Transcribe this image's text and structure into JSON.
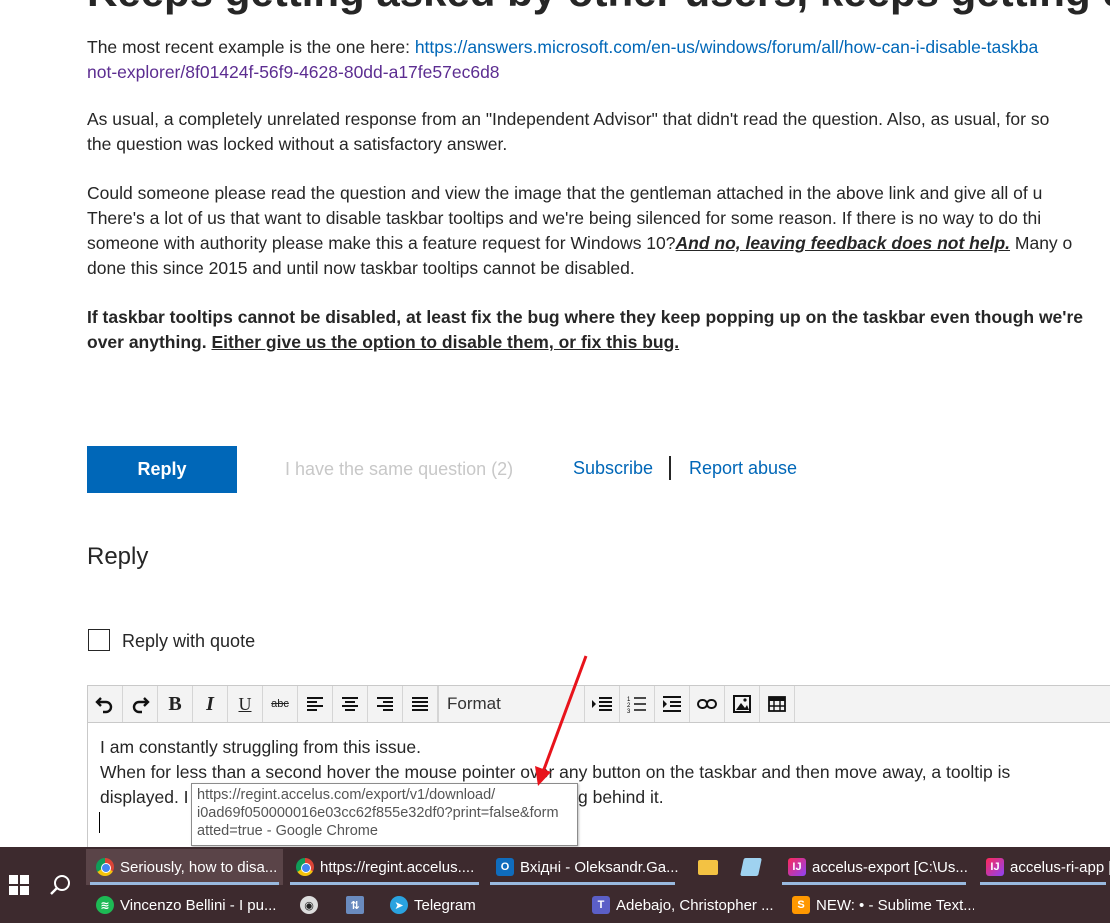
{
  "post": {
    "title": "Keeps getting asked by other users, keeps getting de",
    "p1_prefix": "The most recent example is the one here: ",
    "p1_link_line1": "https://answers.microsoft.com/en-us/windows/forum/all/how-can-i-disable-taskba",
    "p1_link_line2": "not-explorer/8f01424f-56f9-4628-80dd-a17fe57ec6d8",
    "p2_line1": "As usual, a completely unrelated response from an \"Independent Advisor\" that didn't read the question. Also, as usual, for so",
    "p2_line2": "the question was locked without a satisfactory answer.",
    "p3_line1": "Could someone please read the question and view the image that the gentleman attached in the above link and give all of u",
    "p3_line2": "There's a lot of us that want to disable taskbar tooltips and we're being silenced for some reason. If there is no way to do thi",
    "p3_line3_prefix": "someone with authority please make this a feature request for Windows 10?",
    "p3_line3_emph": "And no, leaving feedback does not help.",
    "p3_line3_suffix": " Many o",
    "p3_line4": "done this since 2015 and until now taskbar tooltips cannot be disabled.",
    "p4_line1": "If taskbar tooltips cannot be disabled, at least fix the bug where they keep popping up on the taskbar even though we're",
    "p4_line2_prefix": "over anything. ",
    "p4_line2_underline": "Either give us the option to disable them, or fix this bug."
  },
  "actions": {
    "reply_button": "Reply",
    "same_question": "I have the same question (2)",
    "subscribe": "Subscribe",
    "separator": "|",
    "report_abuse": "Report abuse"
  },
  "reply_section": {
    "heading": "Reply",
    "quote_checkbox_label": "Reply with quote",
    "quote_checked": false
  },
  "toolbar": {
    "format_label": "Format",
    "bold": "B",
    "italic": "I",
    "underline": "U",
    "strike": "abc"
  },
  "editor": {
    "line1": "I am constantly struggling from this issue.",
    "line2": "When for less than a second hover the mouse pointer over any button on the taskbar and then move away, a tooltip is",
    "line3_start": "displayed. I",
    "line3_end": "g behind it."
  },
  "tooltip": {
    "line1": "https://regint.accelus.com/export/v1/download/",
    "line2": "i0ad69f050000016e03cc62f855e32df0?print=false&form",
    "line3": "atted=true - Google Chrome"
  },
  "taskbar": {
    "row1": [
      {
        "label": "Seriously, how to disa...",
        "icon": "chrome-icon",
        "state": "active"
      },
      {
        "label": "https://regint.accelus....",
        "icon": "chrome-icon",
        "state": "open"
      },
      {
        "label": "Вхідні - Oleksandr.Ga...",
        "icon": "outlook-icon",
        "state": "open"
      },
      {
        "label": "",
        "icon": "folder-icon",
        "state": "pinned"
      },
      {
        "label": "",
        "icon": "notepad-icon",
        "state": "pinned"
      },
      {
        "label": "accelus-export [C:\\Us...",
        "icon": "intellij-icon",
        "state": "open"
      },
      {
        "label": "accelus-ri-app [",
        "icon": "intellij-icon",
        "state": "open"
      }
    ],
    "row2": [
      {
        "label": "Vincenzo Bellini - I pu...",
        "icon": "spotify-icon"
      },
      {
        "label": "",
        "icon": "alien-icon"
      },
      {
        "label": "",
        "icon": "network-icon"
      },
      {
        "label": "Telegram",
        "icon": "telegram-icon"
      },
      {
        "label": "Adebajo, Christopher ...",
        "icon": "teams-icon"
      },
      {
        "label": "NEW: • - Sublime Text...",
        "icon": "sublime-icon"
      }
    ]
  },
  "colors": {
    "accent_blue": "#0067b8",
    "visited_link": "#5c2d91",
    "taskbar_bg": "#3d2a2e",
    "annotation_arrow": "#e8131b"
  }
}
